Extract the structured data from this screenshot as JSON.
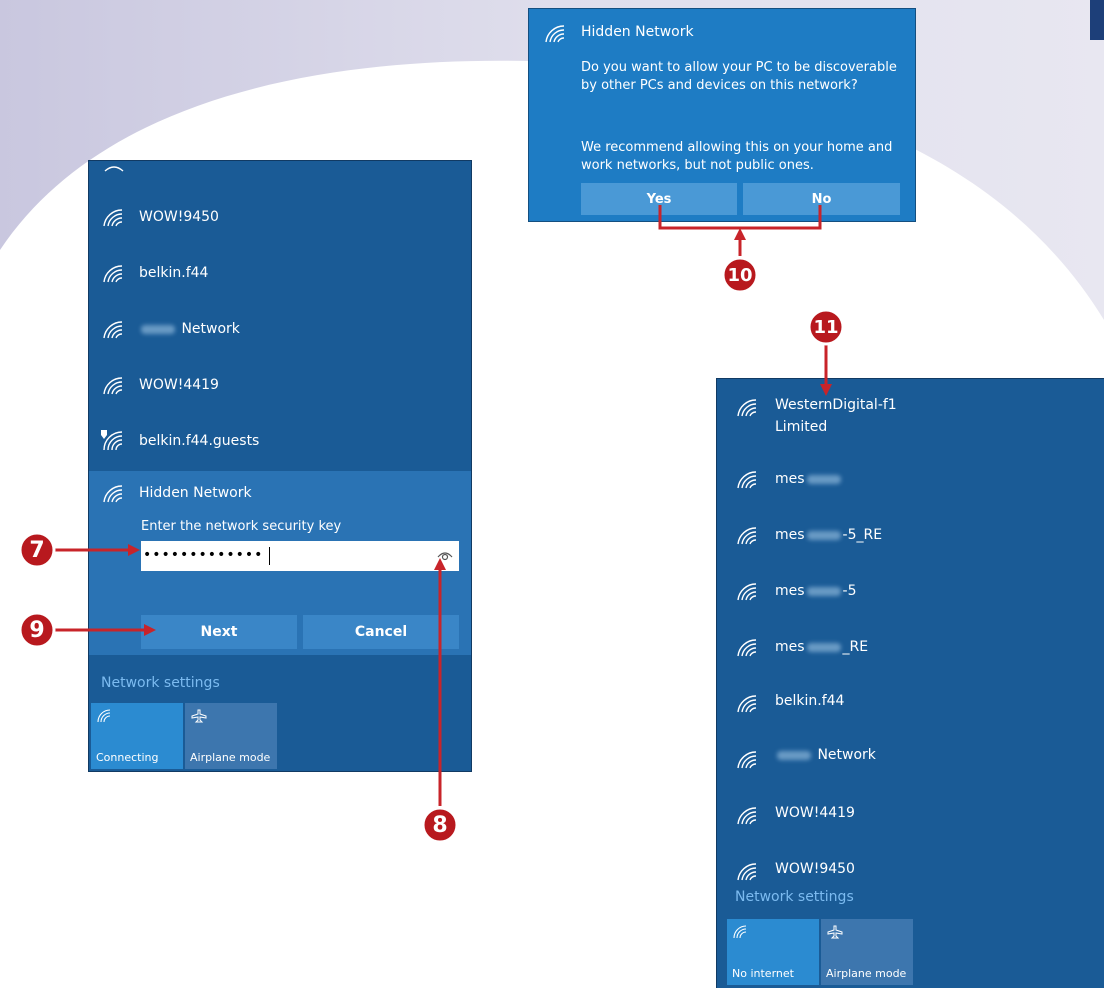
{
  "left_panel": {
    "networks": [
      {
        "name": "WOW!9450",
        "icon": "wifi-icon"
      },
      {
        "name": "belkin.f44",
        "icon": "wifi-icon"
      },
      {
        "name": "Network",
        "icon": "wifi-icon",
        "blurred_prefix": true
      },
      {
        "name": "WOW!4419",
        "icon": "wifi-icon"
      },
      {
        "name": "belkin.f44.guests",
        "icon": "wifi-shield-icon"
      }
    ],
    "selected": {
      "name": "Hidden Network",
      "prompt": "Enter the network security key",
      "key_value": "•••••••••••••",
      "next_label": "Next",
      "cancel_label": "Cancel"
    },
    "network_settings": "Network settings",
    "tiles": [
      {
        "label": "Connecting",
        "icon": "wifi-icon",
        "active": true
      },
      {
        "label": "Airplane mode",
        "icon": "airplane-icon",
        "active": false
      }
    ]
  },
  "dialog": {
    "title": "Hidden Network",
    "question": "Do you want to allow your PC to be discoverable by other PCs and devices on this network?",
    "recommendation": "We recommend allowing this on your home and work networks, but not public ones.",
    "yes_label": "Yes",
    "no_label": "No"
  },
  "right_panel": {
    "networks": [
      {
        "name": "WesternDigital-f1",
        "status": "Limited"
      },
      {
        "name_pre": "mes",
        "name_post": ""
      },
      {
        "name_pre": "mes",
        "name_post": "-5_RE"
      },
      {
        "name_pre": "mes",
        "name_post": "-5"
      },
      {
        "name_pre": "mes",
        "name_post": "_RE"
      },
      {
        "name": "belkin.f44"
      },
      {
        "name": "Network",
        "blurred_prefix": true
      },
      {
        "name": "WOW!4419"
      },
      {
        "name": "WOW!9450"
      }
    ],
    "network_settings": "Network settings",
    "tiles": [
      {
        "label": "No internet",
        "icon": "wifi-icon",
        "active": true
      },
      {
        "label": "Airplane mode",
        "icon": "airplane-icon",
        "active": false
      }
    ]
  },
  "callouts": [
    "7",
    "8",
    "9",
    "10",
    "11"
  ],
  "colors": {
    "panel_bg": "#1a5b96",
    "selected_bg": "#2a73b4",
    "dialog_bg": "#1e7cc4",
    "button_bg": "#3a86c7",
    "active_tile": "#2b8bd1",
    "link": "#7cbbf0",
    "callout_red": "#b8191e",
    "arrow_red": "#c8242a",
    "background_lavender": "#d8d7e8"
  }
}
